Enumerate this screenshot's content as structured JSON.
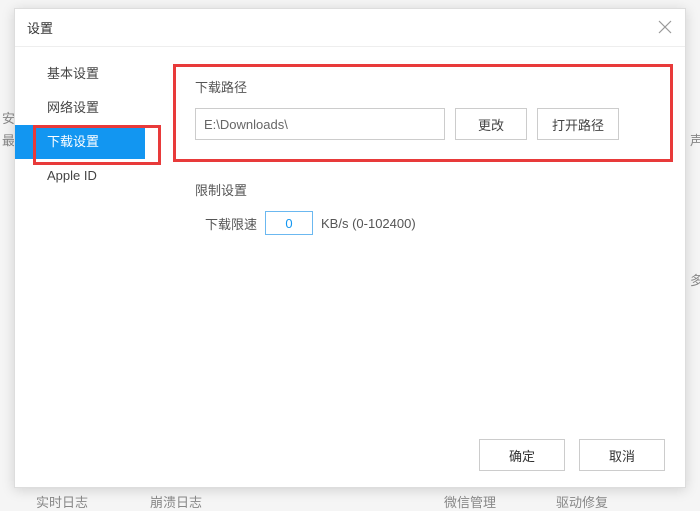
{
  "dialog": {
    "title": "设置"
  },
  "sidebar": {
    "items": [
      {
        "label": "基本设置"
      },
      {
        "label": "网络设置"
      },
      {
        "label": "下载设置"
      },
      {
        "label": "Apple ID"
      }
    ]
  },
  "content": {
    "download_path": {
      "title": "下载路径",
      "value": "E:\\Downloads\\",
      "change_btn": "更改",
      "open_btn": "打开路径"
    },
    "limit": {
      "title": "限制设置",
      "label": "下载限速",
      "value": "0",
      "unit_hint": "KB/s (0-102400)"
    }
  },
  "footer": {
    "ok": "确定",
    "cancel": "取消"
  },
  "background": {
    "t1": "安",
    "t2": "最",
    "t3": "声",
    "t4": "多",
    "t5": "实时日志",
    "t6": "崩溃日志",
    "t7": "微信管理",
    "t8": "驱动修复"
  }
}
